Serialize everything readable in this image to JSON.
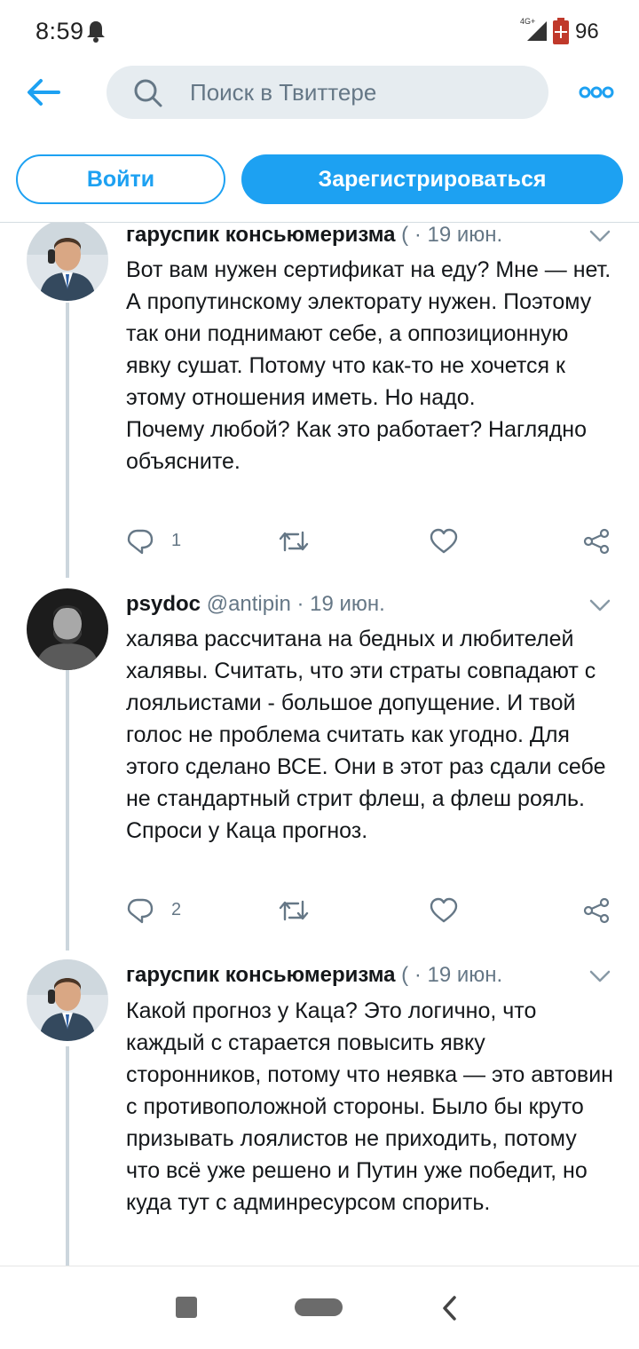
{
  "status_bar": {
    "time": "8:59",
    "network": "4G+",
    "battery": "96",
    "icons": [
      "bell-icon",
      "signal-icon",
      "battery-icon"
    ]
  },
  "header": {
    "back_icon": "arrow-left-icon",
    "search_placeholder": "Поиск в Твиттере",
    "more_icon": "more-icon"
  },
  "auth": {
    "login_label": "Войти",
    "signup_label": "Зарегистрироваться"
  },
  "tweets": [
    {
      "author": "гаруспик консьюмеризма",
      "handle": "(",
      "separator": "·",
      "date": "19 июн.",
      "text": "Вот вам нужен сертификат на еду? Мне — нет. А пропутинскому электорату нужен. Поэтому так они поднимают себе, а оппозиционную явку сушат. Потому что как-то не хочется к этому отношения иметь. Но надо.\nПочему любой? Как это работает? Наглядно объясните.",
      "reply_count": "1"
    },
    {
      "author": "psydoc",
      "handle": "@antipin",
      "separator": "·",
      "date": "19 июн.",
      "text": "халява рассчитана на бедных и любителей халявы. Считать, что эти страты совпадают с лояльистами - большое допущение. И твой голос не проблема считать как угодно. Для этого сделано ВСЕ.  Они в этот раз сдали себе не стандартный стрит флеш, а флеш рояль. Спроси у Каца прогноз.",
      "reply_count": "2"
    },
    {
      "author": "гаруспик консьюмеризма",
      "handle": "(",
      "separator": "·",
      "date": "19 июн.",
      "text": "Какой прогноз у Каца? Это логично, что каждый с старается повысить явку сторонников, потому что неявка — это автовин с противоположной стороны. Было бы круто призывать лоялистов не приходить, потому что всё уже решено и Путин уже победит, но куда тут с админресурсом спорить."
    }
  ],
  "colors": {
    "accent": "#1da1f2",
    "text": "#14171a",
    "secondary": "#657786",
    "search_bg": "#e6ecf0",
    "thread_line": "#ccd6dd"
  }
}
